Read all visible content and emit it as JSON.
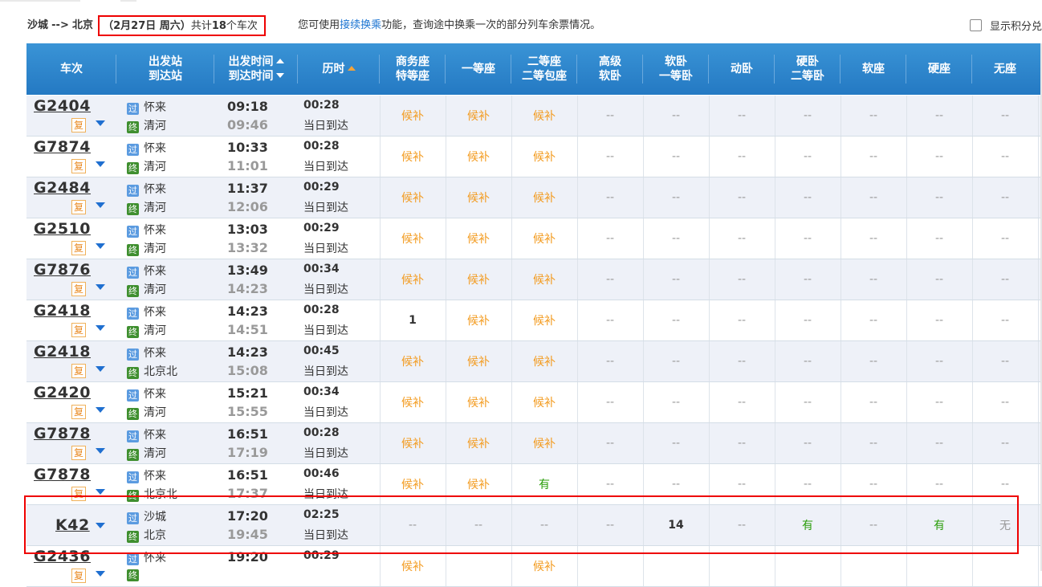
{
  "summary": {
    "from": "沙城",
    "arrow": "-->",
    "to": "北京",
    "date_text": "（2月27日  周六）",
    "total_prefix": "共计",
    "total_count": "18",
    "total_suffix": "个车次",
    "hint_prefix": "您可使用",
    "hint_link": "接续换乘",
    "hint_suffix": "功能，查询途中换乘一次的部分列车余票情况。"
  },
  "points_label": "显示积分兑",
  "columns": [
    {
      "l1": "车次",
      "l2": ""
    },
    {
      "l1": "出发站",
      "l2": "到达站"
    },
    {
      "l1": "出发时间",
      "l2": "到达时间"
    },
    {
      "l1": "历时",
      "l2": ""
    },
    {
      "l1": "商务座",
      "l2": "特等座"
    },
    {
      "l1": "一等座",
      "l2": ""
    },
    {
      "l1": "二等座",
      "l2": "二等包座"
    },
    {
      "l1": "高级",
      "l2": "软卧"
    },
    {
      "l1": "软卧",
      "l2": "一等卧"
    },
    {
      "l1": "动卧",
      "l2": ""
    },
    {
      "l1": "硬卧",
      "l2": "二等卧"
    },
    {
      "l1": "软座",
      "l2": ""
    },
    {
      "l1": "硬座",
      "l2": ""
    },
    {
      "l1": "无座",
      "l2": ""
    }
  ],
  "colors": {
    "header": "#2a80c8",
    "waitlist": "#f39b1f",
    "available": "#2a9d0a",
    "highlight": "#e00000"
  },
  "icons": {
    "pass_badge": "过",
    "end_badge": "终",
    "repeat_badge": "复"
  },
  "trains": [
    {
      "no": "G2404",
      "from": "怀来",
      "to": "清河",
      "dep": "09:18",
      "arr": "09:46",
      "dur": "00:28",
      "note": "当日到达",
      "repeat": true,
      "seats": [
        "候补",
        "候补",
        "候补",
        "--",
        "--",
        "--",
        "--",
        "--",
        "--",
        "--"
      ]
    },
    {
      "no": "G7874",
      "from": "怀来",
      "to": "清河",
      "dep": "10:33",
      "arr": "11:01",
      "dur": "00:28",
      "note": "当日到达",
      "repeat": true,
      "seats": [
        "候补",
        "候补",
        "候补",
        "--",
        "--",
        "--",
        "--",
        "--",
        "--",
        "--"
      ]
    },
    {
      "no": "G2484",
      "from": "怀来",
      "to": "清河",
      "dep": "11:37",
      "arr": "12:06",
      "dur": "00:29",
      "note": "当日到达",
      "repeat": true,
      "seats": [
        "候补",
        "候补",
        "候补",
        "--",
        "--",
        "--",
        "--",
        "--",
        "--",
        "--"
      ]
    },
    {
      "no": "G2510",
      "from": "怀来",
      "to": "清河",
      "dep": "13:03",
      "arr": "13:32",
      "dur": "00:29",
      "note": "当日到达",
      "repeat": true,
      "seats": [
        "候补",
        "候补",
        "候补",
        "--",
        "--",
        "--",
        "--",
        "--",
        "--",
        "--"
      ]
    },
    {
      "no": "G7876",
      "from": "怀来",
      "to": "清河",
      "dep": "13:49",
      "arr": "14:23",
      "dur": "00:34",
      "note": "当日到达",
      "repeat": true,
      "seats": [
        "候补",
        "候补",
        "候补",
        "--",
        "--",
        "--",
        "--",
        "--",
        "--",
        "--"
      ]
    },
    {
      "no": "G2418",
      "from": "怀来",
      "to": "清河",
      "dep": "14:23",
      "arr": "14:51",
      "dur": "00:28",
      "note": "当日到达",
      "repeat": true,
      "seats": [
        "1",
        "候补",
        "候补",
        "--",
        "--",
        "--",
        "--",
        "--",
        "--",
        "--"
      ]
    },
    {
      "no": "G2418",
      "from": "怀来",
      "to": "北京北",
      "dep": "14:23",
      "arr": "15:08",
      "dur": "00:45",
      "note": "当日到达",
      "repeat": true,
      "seats": [
        "候补",
        "候补",
        "候补",
        "--",
        "--",
        "--",
        "--",
        "--",
        "--",
        "--"
      ]
    },
    {
      "no": "G2420",
      "from": "怀来",
      "to": "清河",
      "dep": "15:21",
      "arr": "15:55",
      "dur": "00:34",
      "note": "当日到达",
      "repeat": true,
      "seats": [
        "候补",
        "候补",
        "候补",
        "--",
        "--",
        "--",
        "--",
        "--",
        "--",
        "--"
      ]
    },
    {
      "no": "G7878",
      "from": "怀来",
      "to": "清河",
      "dep": "16:51",
      "arr": "17:19",
      "dur": "00:28",
      "note": "当日到达",
      "repeat": true,
      "seats": [
        "候补",
        "候补",
        "候补",
        "--",
        "--",
        "--",
        "--",
        "--",
        "--",
        "--"
      ]
    },
    {
      "no": "G7878",
      "from": "怀来",
      "to": "北京北",
      "dep": "16:51",
      "arr": "17:37",
      "dur": "00:46",
      "note": "当日到达",
      "repeat": true,
      "seats": [
        "候补",
        "候补",
        "有",
        "--",
        "--",
        "--",
        "--",
        "--",
        "--",
        "--"
      ]
    },
    {
      "no": "K42",
      "from": "沙城",
      "to": "北京",
      "dep": "17:20",
      "arr": "19:45",
      "dur": "02:25",
      "note": "当日到达",
      "repeat": false,
      "seats": [
        "--",
        "--",
        "--",
        "--",
        "14",
        "--",
        "有",
        "--",
        "有",
        "无"
      ]
    },
    {
      "no": "G2436",
      "from": "怀来",
      "to": "",
      "dep": "19:20",
      "arr": "",
      "dur": "00:29",
      "note": "",
      "repeat": true,
      "seats": [
        "候补",
        "",
        "候补",
        "",
        "",
        "",
        "",
        "",
        "",
        ""
      ]
    }
  ]
}
